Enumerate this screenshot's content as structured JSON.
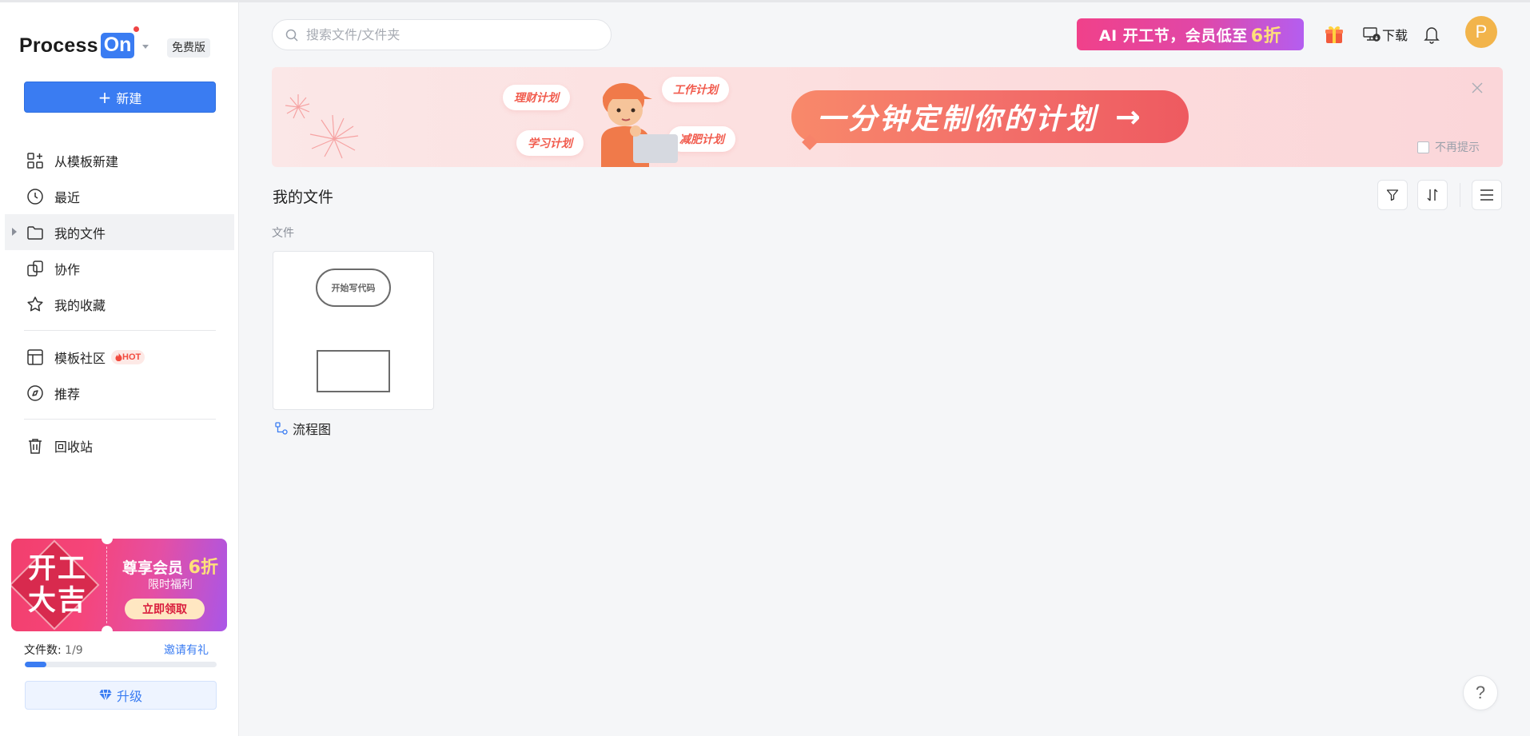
{
  "brand": {
    "logo_text": "Process",
    "logo_on": "On",
    "edition": "免费版",
    "accent": "#3a7cf2"
  },
  "sidebar": {
    "new_label": "新建",
    "items": [
      {
        "label": "从模板新建",
        "icon": "grid-plus-icon"
      },
      {
        "label": "最近",
        "icon": "clock-icon"
      },
      {
        "label": "我的文件",
        "icon": "folder-icon",
        "active": true
      },
      {
        "label": "协作",
        "icon": "collaborate-icon"
      },
      {
        "label": "我的收藏",
        "icon": "star-icon"
      },
      {
        "label": "模板社区",
        "icon": "template-icon",
        "badge": "HOT"
      },
      {
        "label": "推荐",
        "icon": "compass-icon"
      },
      {
        "label": "回收站",
        "icon": "trash-icon"
      }
    ],
    "promo": {
      "big_text": "开工大吉",
      "title": "尊享会员",
      "discount": "6折",
      "subtitle": "限时福利",
      "button": "立即领取"
    },
    "file_count_label": "文件数:",
    "file_count_value": "1/9",
    "file_count_fraction": 0.111,
    "invite_label": "邀请有礼",
    "upgrade_label": "升级"
  },
  "header": {
    "search_placeholder": "搜索文件/文件夹",
    "ai_banner": "AI 开工节，会员低至",
    "ai_banner_discount": "6折",
    "download_label": "下载",
    "avatar_letter": "P"
  },
  "plan_banner": {
    "tags": [
      "理财计划",
      "工作计划",
      "学习计划",
      "减肥计划"
    ],
    "cta": "一分钟定制你的计划",
    "cta_arrow": "→",
    "no_remind": "不再提示"
  },
  "main": {
    "title": "我的文件",
    "section_label": "文件",
    "files": [
      {
        "name": "流程图",
        "thumb_text": "开始写代码",
        "type_icon": "flowchart-icon"
      }
    ],
    "help_label": "?"
  }
}
